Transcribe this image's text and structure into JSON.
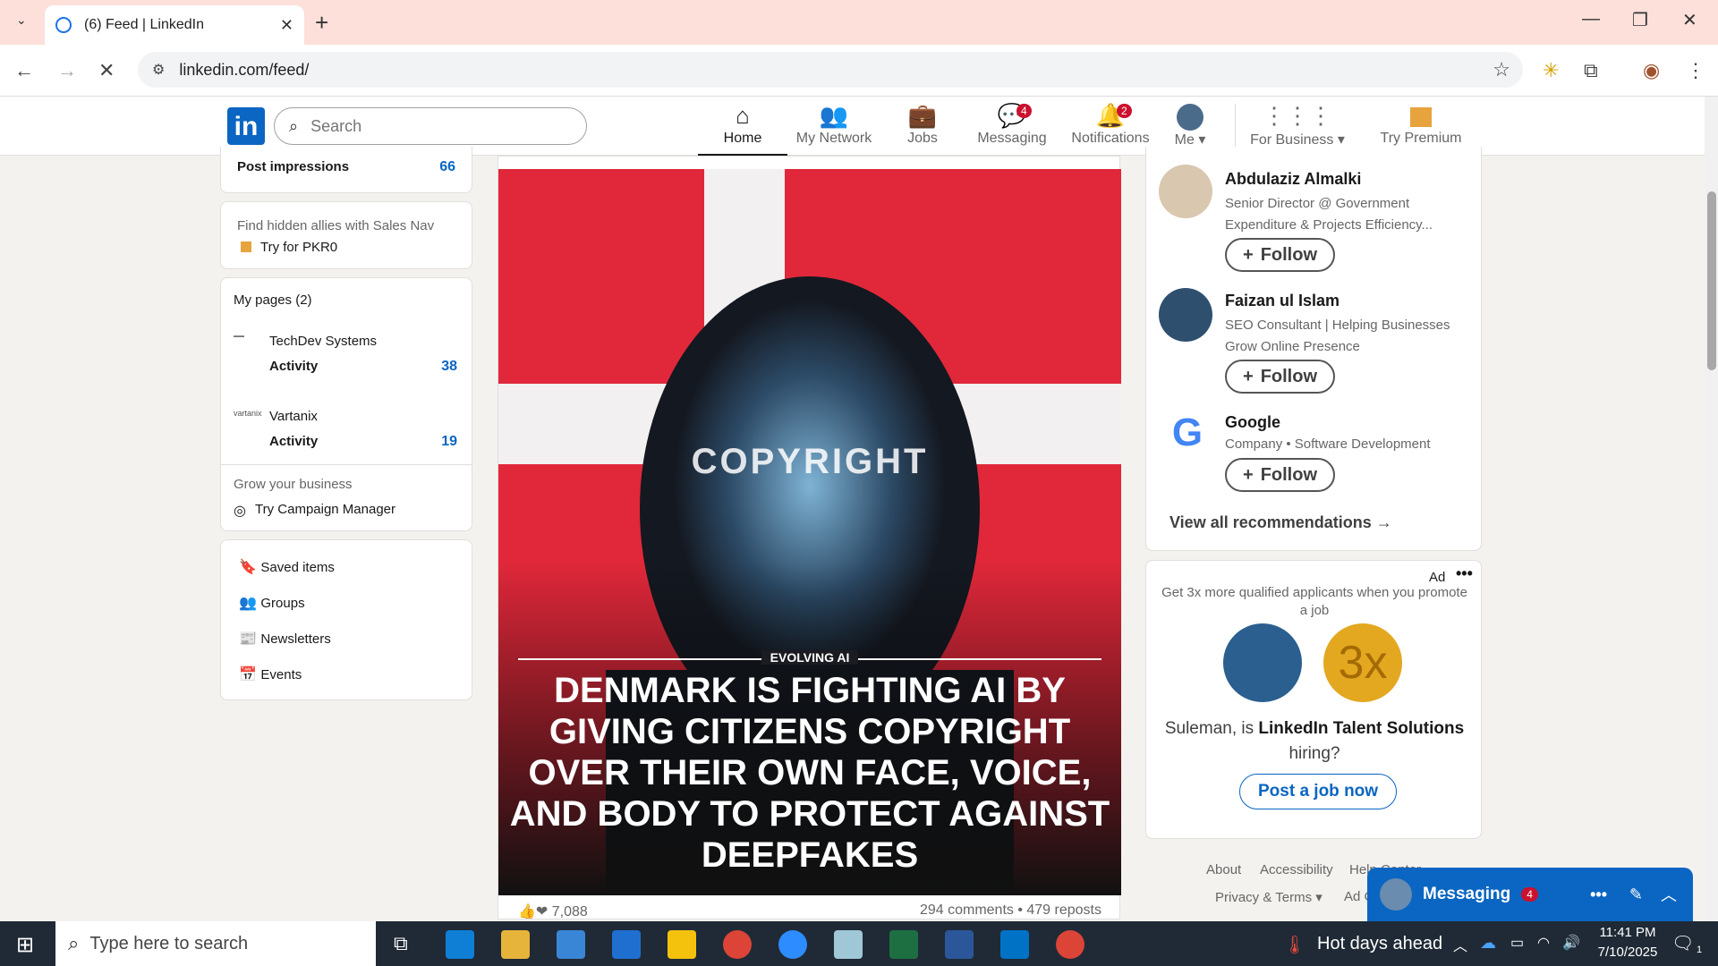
{
  "browser": {
    "tab_title": "(6) Feed | LinkedIn",
    "url": "linkedin.com/feed/"
  },
  "header": {
    "search_placeholder": "Search",
    "nav": [
      {
        "label": "Home",
        "icon": "home-icon",
        "active": true
      },
      {
        "label": "My Network",
        "icon": "people-icon"
      },
      {
        "label": "Jobs",
        "icon": "briefcase-icon"
      },
      {
        "label": "Messaging",
        "icon": "chat-icon",
        "badge": "4"
      },
      {
        "label": "Notifications",
        "icon": "bell-icon",
        "badge": "2"
      },
      {
        "label": "Me",
        "icon": "avatar"
      },
      {
        "label": "For Business",
        "icon": "grid-icon"
      },
      {
        "label": "Try Premium Page",
        "icon": "premium-icon"
      }
    ]
  },
  "left": {
    "impressions_label": "Post impressions",
    "impressions_value": "66",
    "sales_nav_text": "Find hidden allies with Sales Nav",
    "sales_nav_cta": "Try for PKR0",
    "my_pages_title": "My pages (2)",
    "pages": [
      {
        "name": "TechDev Systems",
        "activity_label": "Activity",
        "activity_value": "38"
      },
      {
        "name": "Vartanix",
        "activity_label": "Activity",
        "activity_value": "19"
      }
    ],
    "grow_text": "Grow your business",
    "campaign_cta": "Try Campaign Manager",
    "links": [
      "Saved items",
      "Groups",
      "Newsletters",
      "Events"
    ]
  },
  "post": {
    "overlay_word": "COPYRIGHT",
    "brand": "EVOLVING AI",
    "headline": "DENMARK IS FIGHTING AI BY GIVING CITIZENS COPYRIGHT OVER THEIR OWN FACE, VOICE, AND BODY TO PROTECT AGAINST DEEPFAKES",
    "reactions": "7,088",
    "comments_reposts": "294 comments • 479 reposts"
  },
  "right": {
    "recommendations": [
      {
        "name": "Abdulaziz Almalki",
        "subtitle": "Senior Director @ Government Expenditure & Projects Efficiency...",
        "button": "Follow"
      },
      {
        "name": "Faizan ul Islam",
        "subtitle": "SEO Consultant | Helping Businesses Grow Online Presence",
        "button": "Follow"
      },
      {
        "name": "Google",
        "subtitle": "Company • Software Development",
        "button": "Follow"
      }
    ],
    "view_all": "View all recommendations →",
    "ad_label": "Ad",
    "ad_text": "Get 3x more qualified applicants when you promote a job",
    "ad_badge": "3x",
    "ad_line_prefix": "Suleman, is ",
    "ad_line_company": "LinkedIn Talent Solutions",
    "ad_line_suffix": " hiring?",
    "ad_button": "Post a job now",
    "footer_links": [
      "About",
      "Accessibility",
      "Help Center",
      "Privacy & Terms ▾",
      "Ad Choices"
    ]
  },
  "messaging": {
    "label": "Messaging",
    "badge": "4"
  },
  "taskbar": {
    "search_placeholder": "Type here to search",
    "weather": "Hot days ahead",
    "time": "11:41 PM",
    "date": "7/10/2025",
    "notif_count": "1"
  }
}
